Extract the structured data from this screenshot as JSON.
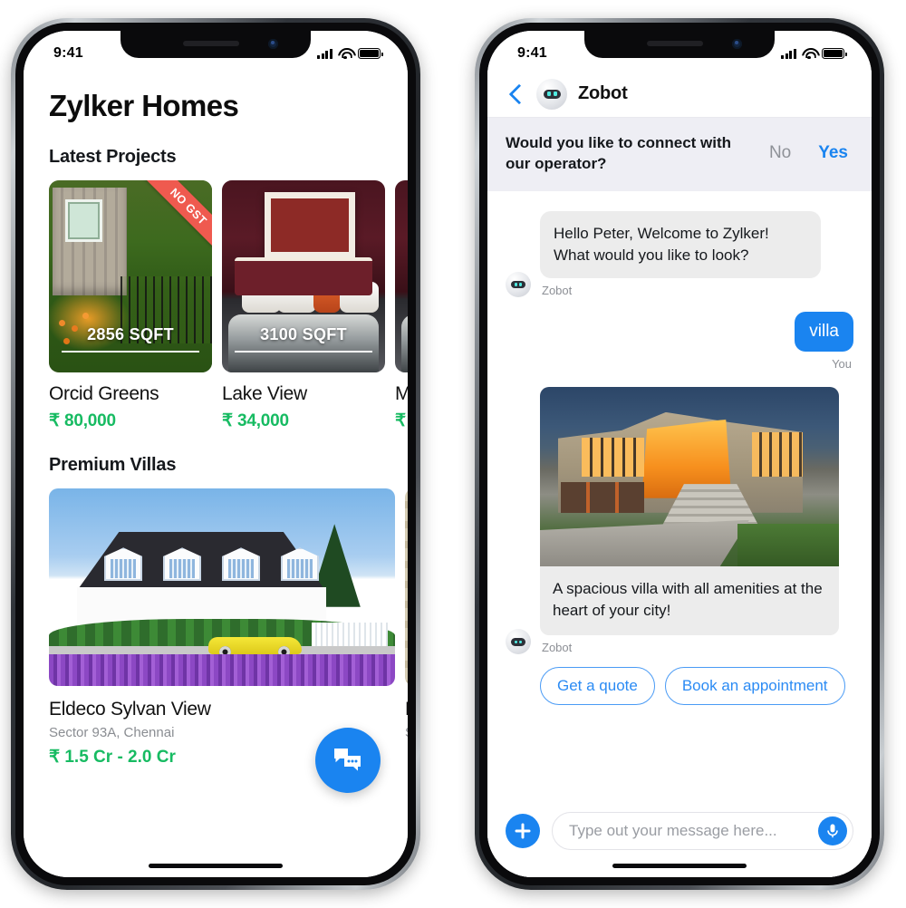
{
  "status_bar": {
    "time": "9:41",
    "signal_icon": "cellular-signal-icon",
    "wifi_icon": "wifi-icon",
    "battery_icon": "battery-icon"
  },
  "left_phone": {
    "app_title": "Zylker Homes",
    "sections": [
      {
        "heading": "Latest Projects"
      },
      {
        "heading": "Premium Villas"
      }
    ],
    "projects": [
      {
        "name": "Orcid Greens",
        "price": "₹ 80,000",
        "sqft": "2856 SQFT",
        "badge": "NO GST",
        "photo": "stone-cottage-garden-photo"
      },
      {
        "name": "Lake View",
        "price": "₹ 34,000",
        "sqft": "3100 SQFT",
        "badge": "",
        "photo": "maroon-bedroom-photo"
      },
      {
        "name": "M",
        "price": "₹",
        "sqft": "",
        "badge": "",
        "photo": "bedroom-partial-photo"
      }
    ],
    "villas": [
      {
        "name": "Eldeco Sylvan View",
        "location": "Sector 93A, Chennai",
        "price": "₹ 1.5 Cr - 2.0 Cr",
        "photo": "white-villa-yellow-car-photo"
      },
      {
        "name": "E",
        "location": "S",
        "price": "",
        "photo": "stone-wall-partial-photo"
      }
    ],
    "fab": {
      "name": "chat-fab",
      "icon": "chat-bubbles-icon"
    }
  },
  "right_phone": {
    "header": {
      "back_icon": "back-chevron-icon",
      "avatar_icon": "zobot-avatar-icon",
      "title": "Zobot"
    },
    "operator_prompt": {
      "question": "Would you like to connect with our operator?",
      "decline_label": "No",
      "accept_label": "Yes"
    },
    "messages": [
      {
        "type": "bot-text",
        "text": "Hello Peter, Welcome to Zylker! What would you like to look?",
        "sender": "Zobot"
      },
      {
        "type": "user-text",
        "text": "villa",
        "sender": "You"
      },
      {
        "type": "bot-card",
        "text": "A spacious villa with all amenities at the heart of your city!",
        "sender": "Zobot",
        "photo": "modern-lit-villa-photo"
      }
    ],
    "quick_replies": [
      "Get a quote",
      "Book an appointment"
    ],
    "composer": {
      "add_icon": "plus-icon",
      "input_value": "",
      "input_placeholder": "Type out your message here...",
      "mic_icon": "microphone-icon"
    }
  },
  "colors": {
    "accent_blue": "#1a84f0",
    "price_green": "#17bb62",
    "ribbon_red": "#ef5a4f",
    "bot_bubble_grey": "#ececec",
    "operator_bar_grey": "#eeeef4"
  }
}
